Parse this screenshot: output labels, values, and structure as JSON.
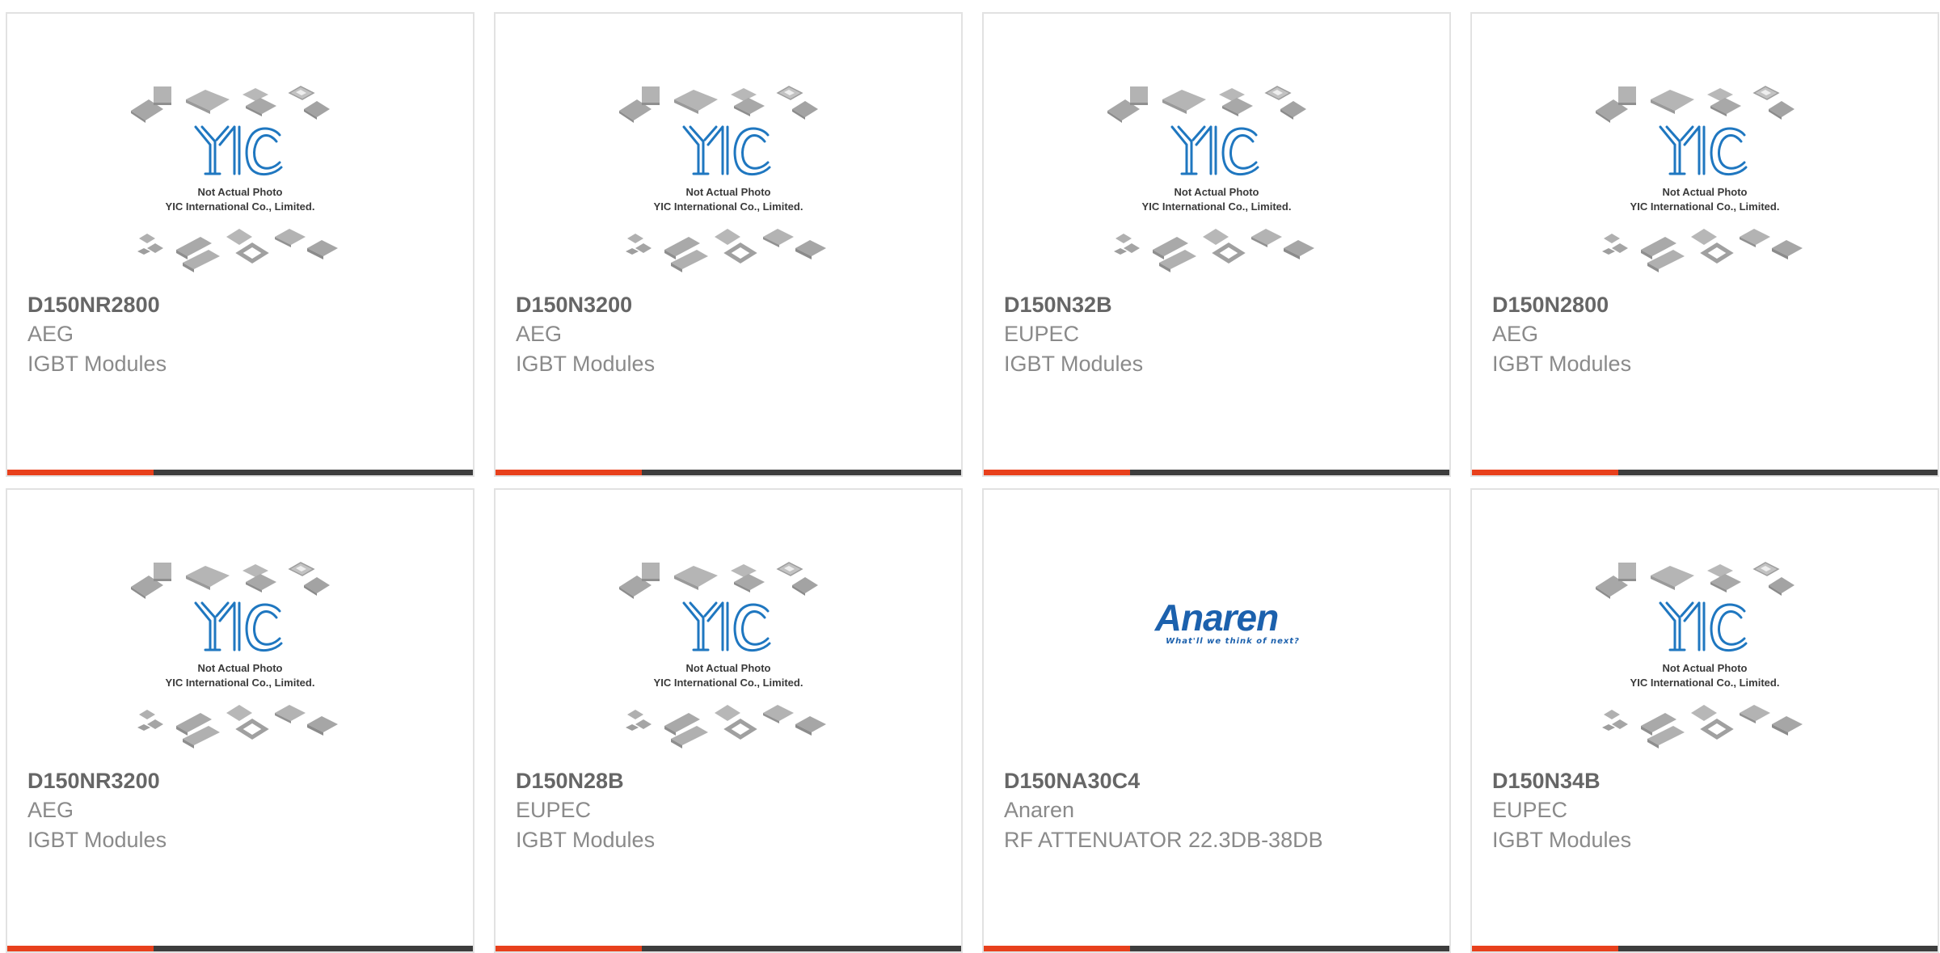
{
  "colors": {
    "accent": "#e8401c",
    "bar": "#3d3d3d",
    "border": "#e2e2e2",
    "yic_blue": "#1f77c0",
    "anaren_blue": "#1c61ad"
  },
  "placeholder": {
    "line1": "Not Actual Photo",
    "line2": "YIC International Co., Limited."
  },
  "anaren_logo": {
    "word": "Anaren",
    "tagline": "What'll we think of next?"
  },
  "products": [
    {
      "part": "D150NR2800",
      "manufacturer": "AEG",
      "category": "IGBT Modules",
      "image": "yic-placeholder"
    },
    {
      "part": "D150N3200",
      "manufacturer": "AEG",
      "category": "IGBT Modules",
      "image": "yic-placeholder"
    },
    {
      "part": "D150N32B",
      "manufacturer": "EUPEC",
      "category": "IGBT Modules",
      "image": "yic-placeholder"
    },
    {
      "part": "D150N2800",
      "manufacturer": "AEG",
      "category": "IGBT Modules",
      "image": "yic-placeholder"
    },
    {
      "part": "D150NR3200",
      "manufacturer": "AEG",
      "category": "IGBT Modules",
      "image": "yic-placeholder"
    },
    {
      "part": "D150N28B",
      "manufacturer": "EUPEC",
      "category": "IGBT Modules",
      "image": "yic-placeholder"
    },
    {
      "part": "D150NA30C4",
      "manufacturer": "Anaren",
      "category": "RF ATTENUATOR 22.3DB-38DB",
      "image": "anaren-logo"
    },
    {
      "part": "D150N34B",
      "manufacturer": "EUPEC",
      "category": "IGBT Modules",
      "image": "yic-placeholder"
    }
  ]
}
